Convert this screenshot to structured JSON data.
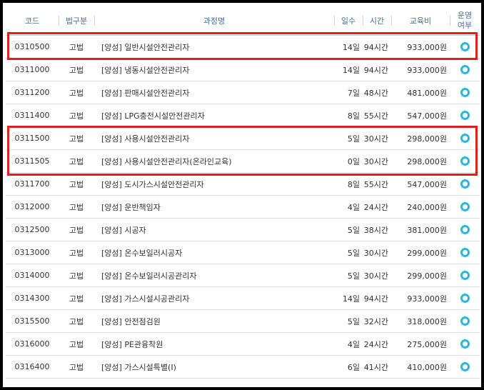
{
  "headers": {
    "code": "코드",
    "law": "법구분",
    "name": "과정명",
    "days": "일수",
    "hours": "시간",
    "fee": "교육비",
    "op_line1": "운영",
    "op_line2": "여부"
  },
  "rows": [
    {
      "code": "0310500",
      "law": "고법",
      "name": "[양성] 일반시설안전관리자",
      "days": "14일",
      "hours": "94시간",
      "fee": "933,000원",
      "op": "circle-icon"
    },
    {
      "code": "0311000",
      "law": "고법",
      "name": "[양성] 냉동시설안전관리자",
      "days": "14일",
      "hours": "94시간",
      "fee": "933,000원",
      "op": "circle-icon"
    },
    {
      "code": "0311200",
      "law": "고법",
      "name": "[양성] 판매시설안전관리자",
      "days": "7일",
      "hours": "48시간",
      "fee": "481,000원",
      "op": "circle-icon"
    },
    {
      "code": "0311400",
      "law": "고법",
      "name": "[양성] LPG충전시설안전관리자",
      "days": "8일",
      "hours": "55시간",
      "fee": "547,000원",
      "op": "circle-icon"
    },
    {
      "code": "0311500",
      "law": "고법",
      "name": "[양성] 사용시설안전관리자",
      "days": "5일",
      "hours": "30시간",
      "fee": "298,000원",
      "op": "circle-icon"
    },
    {
      "code": "0311505",
      "law": "고법",
      "name": "[양성] 사용시설안전관리자(온라인교육)",
      "days": "0일",
      "hours": "30시간",
      "fee": "298,000원",
      "op": "circle-icon"
    },
    {
      "code": "0311700",
      "law": "고법",
      "name": "[양성] 도시가스시설안전관리자",
      "days": "8일",
      "hours": "55시간",
      "fee": "547,000원",
      "op": "circle-icon"
    },
    {
      "code": "0312000",
      "law": "고법",
      "name": "[양성] 운반책임자",
      "days": "4일",
      "hours": "24시간",
      "fee": "240,000원",
      "op": "circle-icon"
    },
    {
      "code": "0312500",
      "law": "고법",
      "name": "[양성] 시공자",
      "days": "5일",
      "hours": "38시간",
      "fee": "381,000원",
      "op": "circle-icon"
    },
    {
      "code": "0313000",
      "law": "고법",
      "name": "[양성] 온수보일러시공자",
      "days": "5일",
      "hours": "30시간",
      "fee": "299,000원",
      "op": "circle-icon"
    },
    {
      "code": "0314000",
      "law": "고법",
      "name": "[양성] 온수보일러시공관리자",
      "days": "5일",
      "hours": "30시간",
      "fee": "299,000원",
      "op": "circle-icon"
    },
    {
      "code": "0314300",
      "law": "고법",
      "name": "[양성] 가스시설시공관리자",
      "days": "14일",
      "hours": "94시간",
      "fee": "933,000원",
      "op": "circle-icon"
    },
    {
      "code": "0315500",
      "law": "고법",
      "name": "[양성] 안전점검원",
      "days": "5일",
      "hours": "32시간",
      "fee": "318,000원",
      "op": "circle-icon"
    },
    {
      "code": "0316000",
      "law": "고법",
      "name": "[양성] PE관융착원",
      "days": "4일",
      "hours": "24시간",
      "fee": "275,000원",
      "op": "circle-icon"
    },
    {
      "code": "0316400",
      "law": "고법",
      "name": "[양성] 가스시설특별(Ⅰ)",
      "days": "6일",
      "hours": "41시간",
      "fee": "410,000원",
      "op": "circle-icon"
    }
  ],
  "colors": {
    "highlight": "#e01e1e",
    "op_circle": "#29b6e6",
    "header_text": "#4a6d9a"
  }
}
